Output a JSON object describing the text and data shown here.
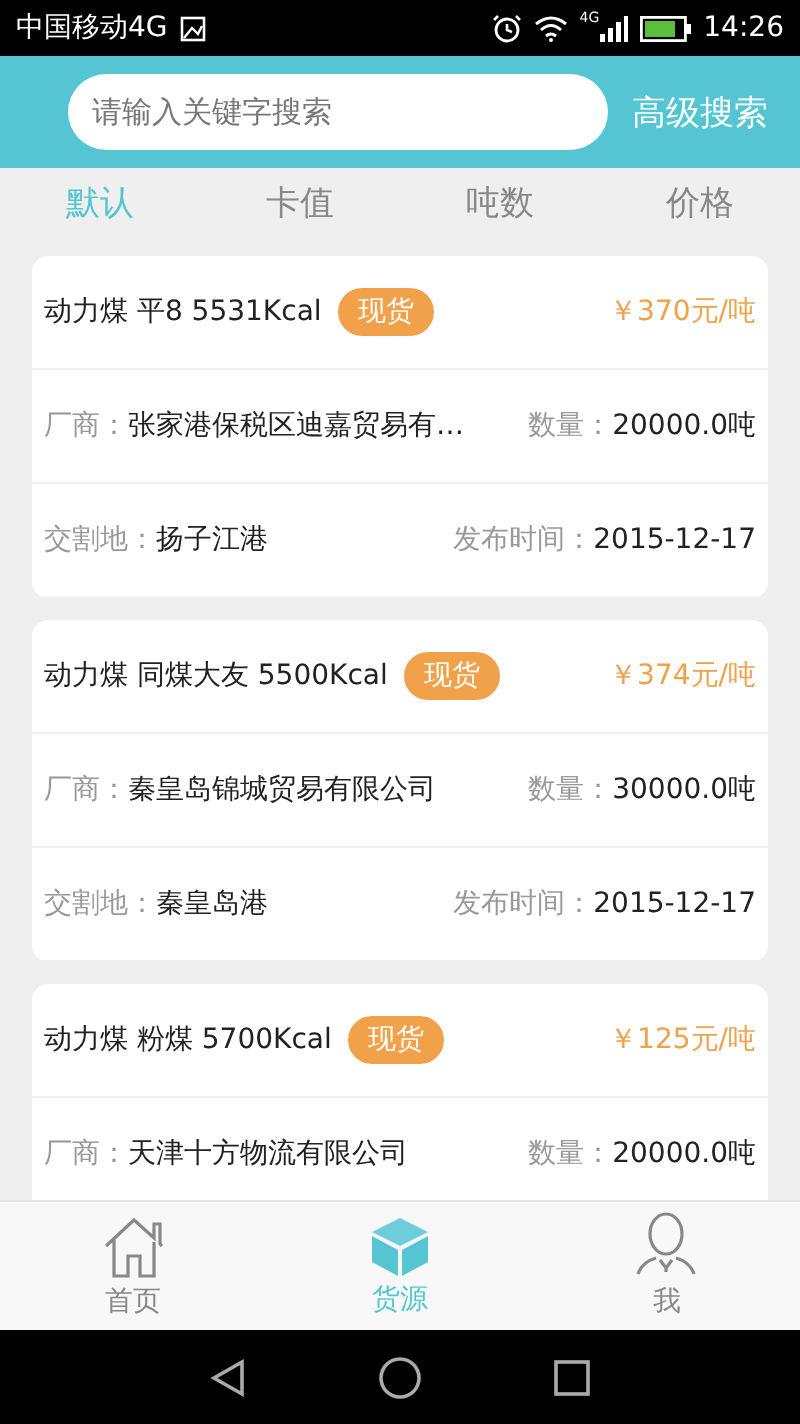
{
  "status_bar": {
    "carrier": "中国移动4G",
    "network": "4G",
    "time": "14:26"
  },
  "header": {
    "search": {
      "placeholder": "请输入关键字搜索"
    },
    "advanced_search": "高级搜索"
  },
  "sort_tabs": [
    {
      "label": "默认",
      "selected": true
    },
    {
      "label": "卡值",
      "selected": false
    },
    {
      "label": "吨数",
      "selected": false
    },
    {
      "label": "价格",
      "selected": false
    }
  ],
  "listings": [
    {
      "title": "动力煤 平8 5531Kcal",
      "badge": "现货",
      "price": "￥370元/吨",
      "rows": [
        {
          "left": {
            "label": "厂商：",
            "value": "张家港保税区迪嘉贸易有…"
          },
          "right": {
            "label": "数量：",
            "value": "20000.0吨"
          }
        },
        {
          "left": {
            "label": "交割地：",
            "value": "扬子江港"
          },
          "right": {
            "label": "发布时间：",
            "value": "2015-12-17"
          }
        }
      ]
    },
    {
      "title": "动力煤 同煤大友 5500Kcal",
      "badge": "现货",
      "price": "￥374元/吨",
      "rows": [
        {
          "left": {
            "label": "厂商：",
            "value": "秦皇岛锦城贸易有限公司"
          },
          "right": {
            "label": "数量：",
            "value": "30000.0吨"
          }
        },
        {
          "left": {
            "label": "交割地：",
            "value": "秦皇岛港"
          },
          "right": {
            "label": "发布时间：",
            "value": "2015-12-17"
          }
        }
      ]
    },
    {
      "title": "动力煤 粉煤 5700Kcal",
      "badge": "现货",
      "price": "￥125元/吨",
      "rows": [
        {
          "left": {
            "label": "厂商：",
            "value": "天津十方物流有限公司"
          },
          "right": {
            "label": "数量：",
            "value": "20000.0吨"
          }
        }
      ]
    }
  ],
  "bottom_nav": [
    {
      "label": "首页",
      "kind": "home",
      "selected": false
    },
    {
      "label": "货源",
      "kind": "box",
      "selected": true
    },
    {
      "label": "我",
      "kind": "person",
      "selected": false
    }
  ]
}
